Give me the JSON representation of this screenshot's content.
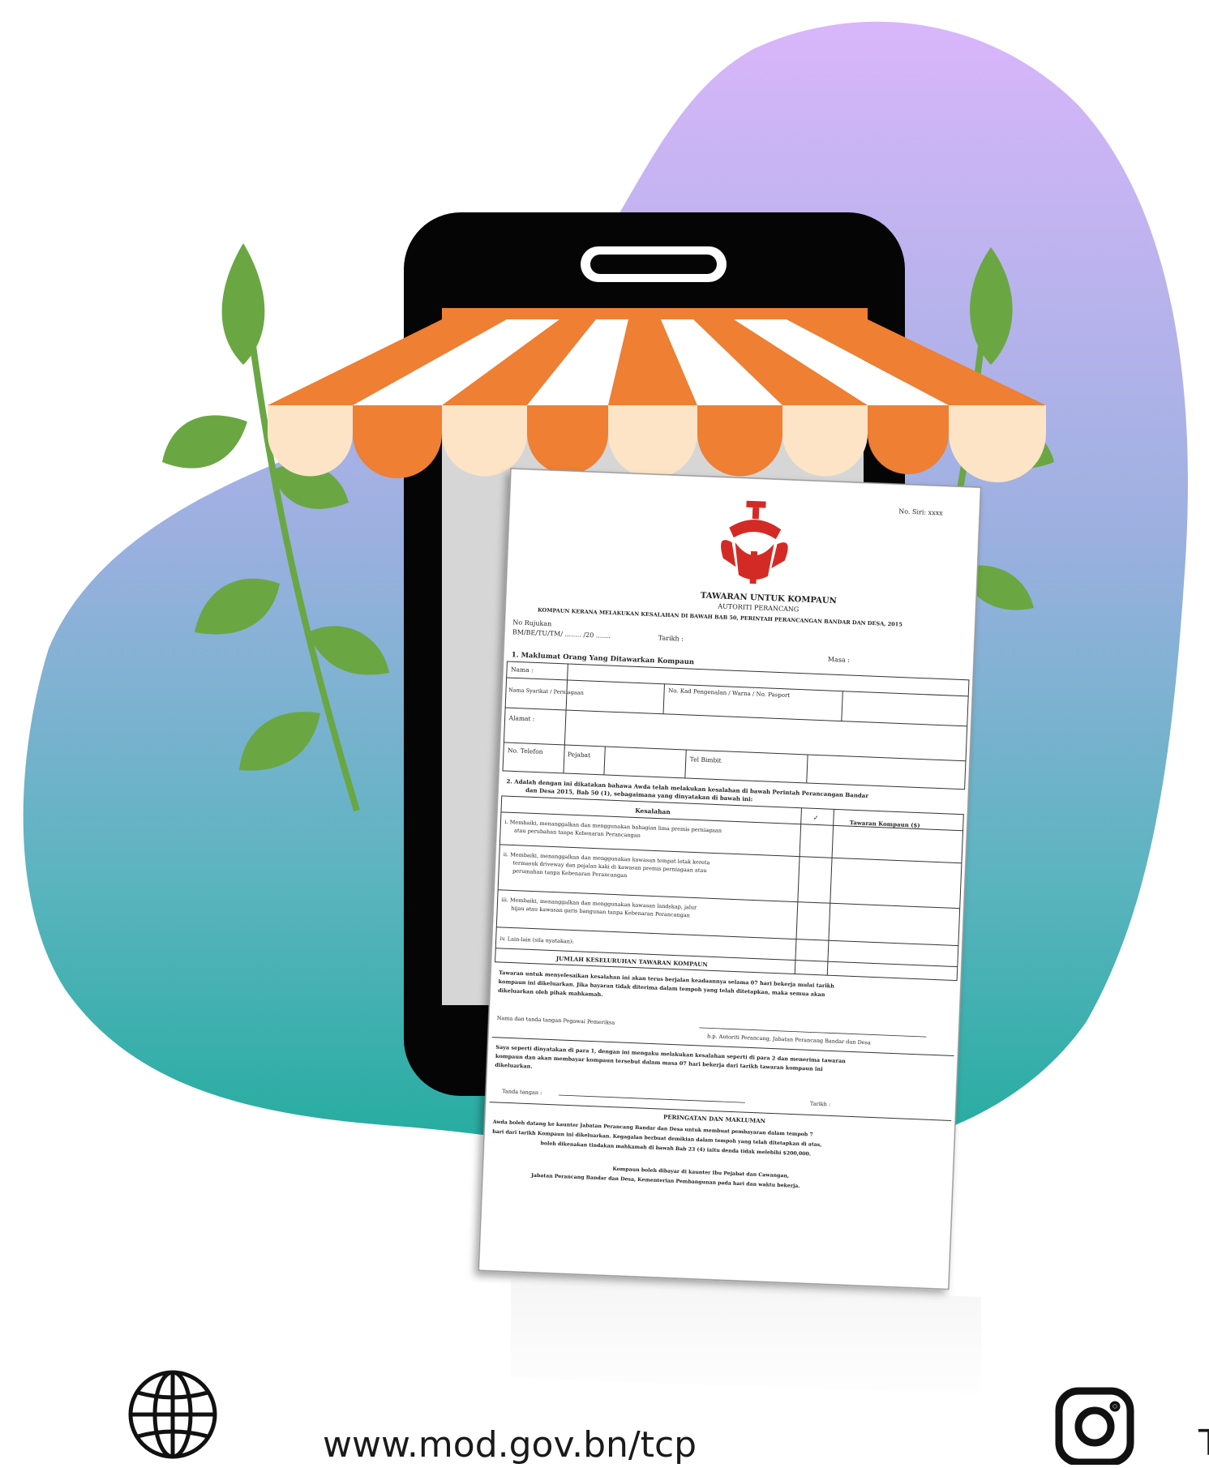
{
  "footer": {
    "website_url": "www.mod.gov.bn/tcp",
    "globe_icon": "globe-icon",
    "instagram_icon": "instagram-icon",
    "instagram_partial_text": "T"
  },
  "document": {
    "ref_no": "No. Siri: xxxx",
    "title": "TAWARAN UNTUK KOMPAUN",
    "subtitle": "AUTORITI PERANCANG",
    "heading": "KOMPAUN KERANA MELAKUKAN KESALAHAN DI BAWAH BAB 50, PERINTAH PERANCANGAN BANDAR DAN DESA, 2015",
    "file_label": "No Rujukan",
    "file_no": "BM/BE/TU/TM/ ........ /20 .......",
    "date_label": "Tarikh :",
    "time_label": "Masa :",
    "section1": "1.    Maklumat Orang Yang Ditawarkan Kompaun",
    "field_name": "Nama :",
    "field_ic": "No. Kad Pengenalan / Warna / No. Pasport",
    "field_company": "Nama Syarikat / Perniagaan",
    "field_address": "Alamat :",
    "field_phone": "No. Telefon",
    "field_office": "Pejabat",
    "field_mobile": "Tel Bimbit",
    "section2_line1": "2.    Adalah dengan ini dikatakan bahawa Awda telah melakukan kesalahan di bawah Perintah Perancangan Bandar",
    "section2_line2": "dan Desa 2015, Bab 50 (1), sebagaimana yang dinyatakan di bawah ini:",
    "col_offence": "Kesalahan",
    "col_tick": "✓",
    "col_amount": "Tawaran Kompaun ($)",
    "offence_1a": "i.   Membaiki, menanggalkan dan menggunakan bahagian lima premis perniagaan",
    "offence_1b": "atau perubahan tanpa Kebenaran Perancangan",
    "offence_2a": "ii.  Membaiki, menanggalkan dan menggunakan kawasan tempat letak kereta",
    "offence_2b": "termasuk driveway dan pejalan kaki di kawasan premis perniagaan atau",
    "offence_2c": "perumahan tanpa Kebenaran Perancangan",
    "offence_3a": "iii. Membaiki, menanggalkan dan menggunakan kawasan landskap, jalur",
    "offence_3b": "hijau atau kawasan garis bangunan tanpa Kebenaran Perancangan",
    "offence_4": "iv. Lain-lain (sila nyatakan):",
    "total_label": "JUMLAH KESELURUHAN TAWARAN KOMPAUN",
    "para_a1": "Tawaran untuk menyelesaikan kesalahan ini akan terus berjalan keadaannya selama 07 hari bekerja mulai tarikh",
    "para_a2": "kompaun ini dikeluarkan. Jika bayaran tidak diterima dalam tempoh yang telah ditetapkan, maka semua akan",
    "para_a3": "dikeluarkan oleh pihak mahkamah.",
    "officer_sig": "Nama dan tanda tangan Pegawai Pemeriksa",
    "officer_for": "b.p. Autoriti Perancang, Jabatan Perancang Bandar dan Desa",
    "para_b1": "Saya seperti dinyatakan di para 1, dengan ini mengaku melakukan kesalahan seperti di para 2 dan menerima tawaran",
    "para_b2": "kompaun dan akan membayar kompaun tersebut dalam masa 07 hari bekerja dari tarikh tawaran kompaun ini",
    "para_b3": "dikeluarkan.",
    "sign_label": "Tanda tangan :",
    "sign_date": "Tarikh :",
    "warning_title": "PERINGATAN DAN MAKLUMAN",
    "warning_1": "Awda boleh datang ke kaunter Jabatan Perancang Bandar dan Desa untuk membuat pembayaran dalam tempoh 7",
    "warning_2": "hari dari tarikh Kompaun ini dikeluarkan. Kegagalan berbuat demikian dalam tempoh yang telah ditetapkan di atas,",
    "warning_3": "boleh dikenakan tindakan mahkamah di bawah Bab 23 (4) iaitu denda tidak melebihi $200,000.",
    "payment_1": "Kompaun boleh dibayar di kaunter Ibu Pejabat dan Cawangan,",
    "payment_2": "Jabatan Perancang Bandar dan Desa, Kementerian Pembangunan pada hari dan waktu bekerja."
  },
  "colors": {
    "blob_top": "#d7b4f8",
    "blob_mid": "#8fa9dd",
    "blob_bottom": "#25ad9f",
    "phone": "#050505",
    "awning_orange": "#ee7f33",
    "awning_cream": "#fde4c6",
    "leaf_green": "#6aa743",
    "emblem_red": "#d42a25"
  }
}
